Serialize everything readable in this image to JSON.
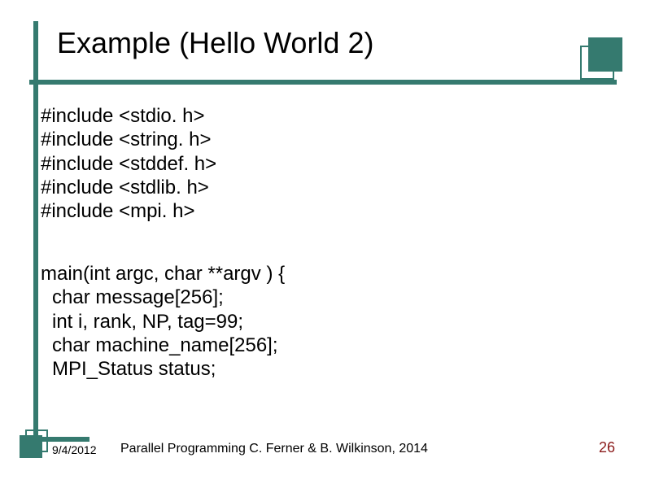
{
  "title": "Example (Hello World 2)",
  "code": {
    "includes": [
      "#include <stdio. h>",
      "#include <string. h>",
      "#include <stddef. h>",
      "#include <stdlib. h>",
      "#include <mpi. h>"
    ],
    "main": [
      "main(int argc, char **argv ) {",
      "char message[256];",
      "int i, rank, NP, tag=99;",
      "char machine_name[256];",
      "MPI_Status status;"
    ]
  },
  "footer": {
    "date": "9/4/2012",
    "text": "Parallel Programming  C. Ferner & B. Wilkinson, 2014",
    "slide_number": "26"
  }
}
